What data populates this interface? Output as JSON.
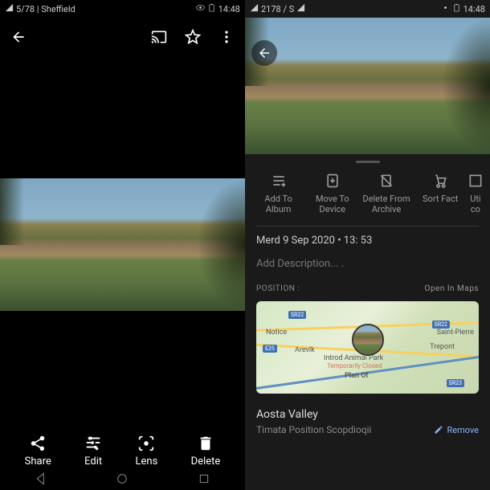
{
  "statusLeft": {
    "signal1": "signal",
    "netText": "5/78 | Sheffield",
    "netText2": "2178 / S"
  },
  "statusRight": {
    "time": "14:48",
    "battery": "battery"
  },
  "leftActions": {
    "share": "Share",
    "edit": "Edit",
    "lens": "Lens",
    "delete": "Delete"
  },
  "rightActions": {
    "addAlbum": "Add To Album",
    "moveDevice": "Move To Device",
    "deleteArchive": "Delete From Archive",
    "sortFact": "Sort Fact",
    "util": "Uti co"
  },
  "date": "Merd 9 Sep 2020 • 13: 53",
  "addDescription": "Add Description... .",
  "positionLabel": "POSITION :",
  "openMaps": "Open In Maps",
  "map": {
    "notice": "Notice",
    "arevik": "Arevik",
    "introd": "Introd Animal Park",
    "closed": "Temporarily Closed",
    "planOf": "Plan Of",
    "saintPierre": "Saint-Pierre",
    "trepont": "Trepont",
    "sr22": "SR22",
    "sr23": "SR23",
    "e25": "E25"
  },
  "locationName": "Aosta Valley",
  "locationDetail": "Timata Position Scopdioqii",
  "remove": "Remove"
}
